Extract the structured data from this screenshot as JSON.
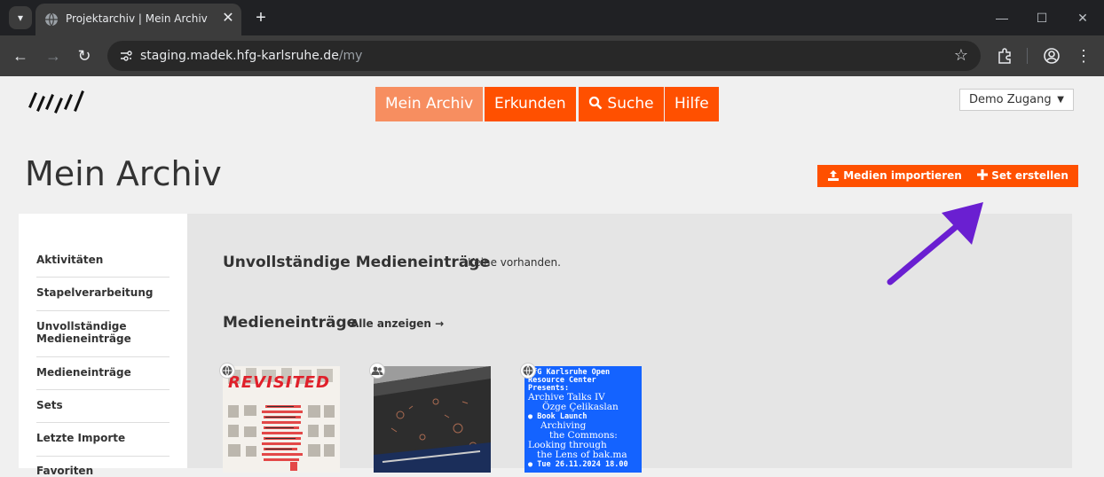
{
  "browser": {
    "tab_title": "Projektarchiv | Mein Archiv",
    "url_host": "staging.madek.hfg-karlsruhe.de",
    "url_path": "/my",
    "icons": [
      "tab-search-icon",
      "globe-icon",
      "close-icon",
      "plus-icon",
      "back-icon",
      "forward-icon",
      "reload-icon",
      "site-info-icon",
      "star-icon",
      "extensions-icon",
      "profile-icon",
      "menu-icon",
      "minimize-icon",
      "maximize-icon",
      "window-close-icon"
    ]
  },
  "header": {
    "nav": [
      {
        "label": "Mein Archiv",
        "active": true
      },
      {
        "label": "Erkunden",
        "active": false
      },
      {
        "label": "Suche",
        "active": false
      },
      {
        "label": "Hilfe",
        "active": false
      }
    ],
    "user_menu": "Demo Zugang"
  },
  "page": {
    "title": "Mein Archiv",
    "import_button": "Medien importieren",
    "create_set_button": "Set erstellen"
  },
  "sidebar": {
    "items": [
      {
        "label": "Aktivitäten"
      },
      {
        "label": "Stapelverarbeitung"
      },
      {
        "label": "Unvollständige Medieneinträge"
      },
      {
        "label": "Medieneinträge"
      },
      {
        "label": "Sets"
      },
      {
        "label": "Letzte Importe"
      },
      {
        "label": "Favoriten"
      }
    ]
  },
  "main": {
    "incomplete_title": "Unvollständige Medieneinträge",
    "incomplete_note": "Keine vorhanden.",
    "entries_title": "Medieneinträge",
    "show_all": "Alle anzeigen →",
    "thumbs": [
      {
        "caption": "REVISITED",
        "visibility": "public"
      },
      {
        "caption": "",
        "visibility": "group"
      },
      {
        "lines": [
          "HfG Karlsruhe Open",
          "Resource Center",
          "Presents:",
          "Archive Talks IV",
          "Özge Çelikaslan",
          "● Book Launch",
          "Archiving",
          "the Commons:",
          "Looking through",
          "the Lens of bak.ma",
          "● Tue 26.11.2024 18.00"
        ],
        "visibility": "public"
      }
    ]
  },
  "colors": {
    "accent": "#ff5000",
    "active_nav": "#f78e60",
    "arrow": "#6a1fd1",
    "poster_blue": "#1463ff"
  }
}
